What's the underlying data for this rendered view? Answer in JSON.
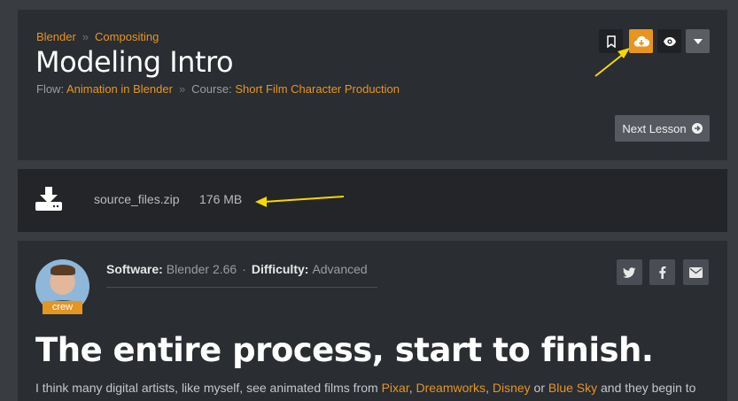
{
  "breadcrumb": [
    "Blender",
    "Compositing"
  ],
  "page_title": "Modeling Intro",
  "flow": {
    "label": "Flow:",
    "value": "Animation in Blender"
  },
  "course": {
    "label": "Course:",
    "value": "Short Film Character Production"
  },
  "toolbar": {
    "bookmark_icon": "bookmark-icon",
    "download_icon": "cloud-download-icon",
    "watch_icon": "eye-icon",
    "more_icon": "caret-down-icon"
  },
  "next_lesson_label": "Next Lesson",
  "download": {
    "file_name": "source_files.zip",
    "file_size": "176 MB"
  },
  "author": {
    "badge": "crew"
  },
  "meta": {
    "software_label": "Software:",
    "software_value": "Blender 2.66",
    "difficulty_label": "Difficulty:",
    "difficulty_value": "Advanced"
  },
  "share": {
    "twitter_icon": "twitter-icon",
    "facebook_icon": "facebook-icon",
    "email_icon": "email-icon"
  },
  "headline": "The entire process, start to finish.",
  "intro": {
    "t1": "I think many digital artists, like myself, see animated films from ",
    "l1": "Pixar",
    "t2": ", ",
    "l2": "Dreamworks",
    "t3": ", ",
    "l3": "Disney",
    "t4": " or ",
    "l4": "Blue Sky",
    "t5": " and they begin to"
  },
  "colors": {
    "accent": "#e59524",
    "panel": "#2a2d31",
    "background": "#393c40",
    "annotation_arrow": "#f5d800"
  }
}
